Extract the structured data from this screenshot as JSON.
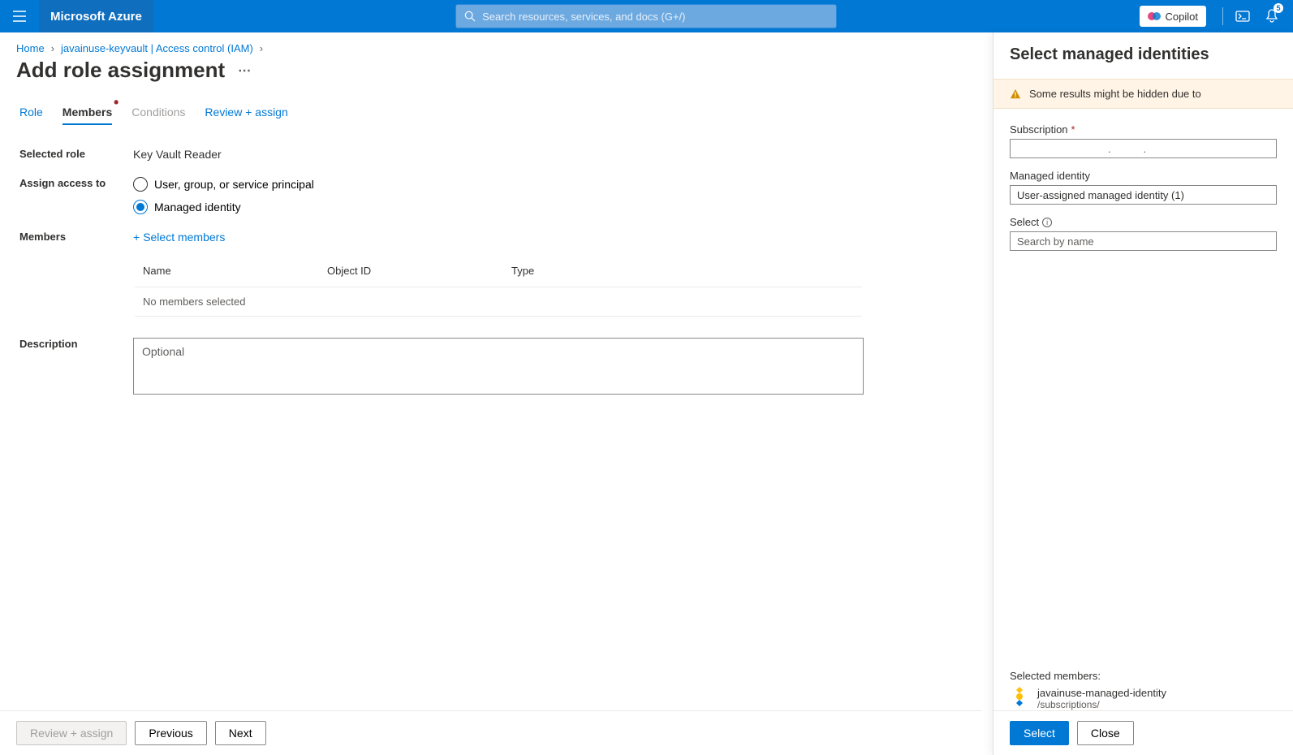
{
  "header": {
    "brand": "Microsoft Azure",
    "search_placeholder": "Search resources, services, and docs (G+/)",
    "copilot": "Copilot",
    "notification_count": "5"
  },
  "breadcrumb": {
    "home": "Home",
    "item2": "javainuse-keyvault | Access control (IAM)"
  },
  "page_title": "Add role assignment",
  "tabs": {
    "role": "Role",
    "members": "Members",
    "conditions": "Conditions",
    "review": "Review + assign"
  },
  "form": {
    "selected_role_label": "Selected role",
    "selected_role_value": "Key Vault Reader",
    "assign_access_label": "Assign access to",
    "radio_user": "User, group, or service principal",
    "radio_managed": "Managed identity",
    "members_label": "Members",
    "select_members": "Select members",
    "col_name": "Name",
    "col_object": "Object ID",
    "col_type": "Type",
    "no_members": "No members selected",
    "description_label": "Description",
    "description_placeholder": "Optional"
  },
  "footer": {
    "review": "Review + assign",
    "prev": "Previous",
    "next": "Next"
  },
  "panel": {
    "title": "Select managed identities",
    "warning": "Some results might be hidden due to",
    "subscription_label": "Subscription",
    "managed_label": "Managed identity",
    "managed_value": "User-assigned managed identity (1)",
    "select_label": "Select",
    "search_placeholder": "Search by name",
    "selected_label": "Selected members:",
    "member_name": "javainuse-managed-identity",
    "member_sub": "/subscriptions/",
    "btn_select": "Select",
    "btn_close": "Close"
  }
}
